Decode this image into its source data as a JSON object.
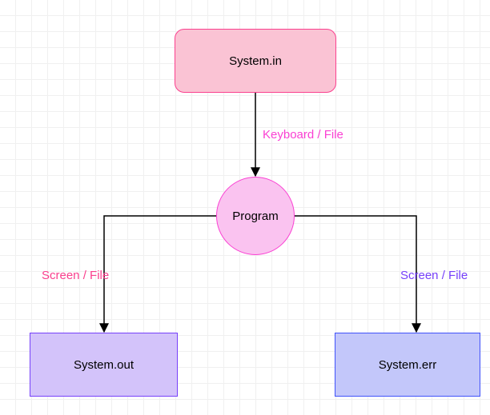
{
  "nodes": {
    "system_in": {
      "text": "System.in",
      "fill": "#fac3d4",
      "stroke": "#fa408e"
    },
    "program": {
      "text": "Program",
      "fill": "#fac3f0",
      "stroke": "#fa40d3"
    },
    "system_out": {
      "text": "System.out",
      "fill": "#d3c3fa",
      "stroke": "#7640fa"
    },
    "system_err": {
      "text": "System.err",
      "fill": "#c3c7fa",
      "stroke": "#4052fa"
    }
  },
  "edges": {
    "in_to_program": {
      "label": "Keyboard / File",
      "label_color": "#fa40d3"
    },
    "program_to_out": {
      "label": "Screen / File",
      "label_color": "#fa408e"
    },
    "program_to_err": {
      "label": "Screen / File",
      "label_color": "#7640fa"
    }
  },
  "chart_data": {
    "type": "diagram",
    "title": "",
    "nodes": [
      {
        "id": "system_in",
        "label": "System.in",
        "shape": "rounded-rect"
      },
      {
        "id": "program",
        "label": "Program",
        "shape": "circle"
      },
      {
        "id": "system_out",
        "label": "System.out",
        "shape": "rect"
      },
      {
        "id": "system_err",
        "label": "System.err",
        "shape": "rect"
      }
    ],
    "edges": [
      {
        "from": "system_in",
        "to": "program",
        "label": "Keyboard / File"
      },
      {
        "from": "program",
        "to": "system_out",
        "label": "Screen / File"
      },
      {
        "from": "program",
        "to": "system_err",
        "label": "Screen / File"
      }
    ]
  }
}
